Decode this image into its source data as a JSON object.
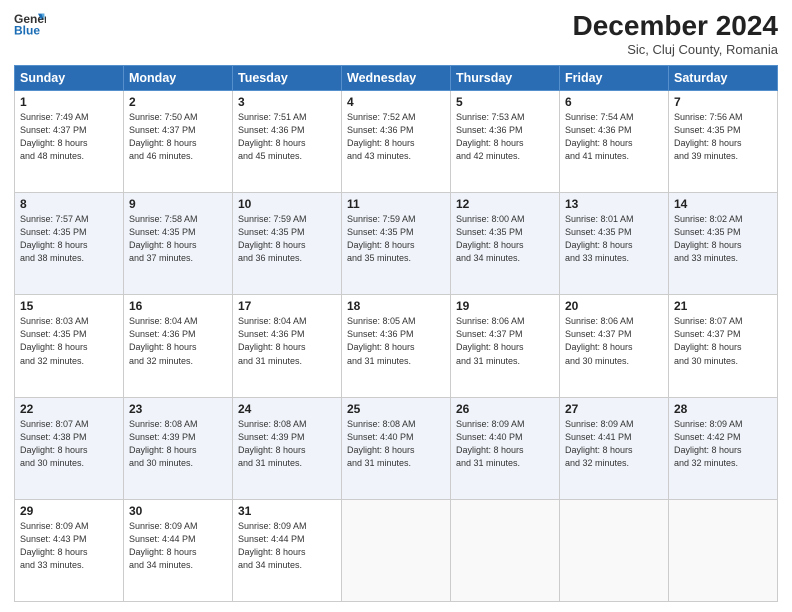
{
  "header": {
    "logo_line1": "General",
    "logo_line2": "Blue",
    "month": "December 2024",
    "location": "Sic, Cluj County, Romania"
  },
  "weekdays": [
    "Sunday",
    "Monday",
    "Tuesday",
    "Wednesday",
    "Thursday",
    "Friday",
    "Saturday"
  ],
  "weeks": [
    [
      {
        "day": "1",
        "info": "Sunrise: 7:49 AM\nSunset: 4:37 PM\nDaylight: 8 hours\nand 48 minutes."
      },
      {
        "day": "2",
        "info": "Sunrise: 7:50 AM\nSunset: 4:37 PM\nDaylight: 8 hours\nand 46 minutes."
      },
      {
        "day": "3",
        "info": "Sunrise: 7:51 AM\nSunset: 4:36 PM\nDaylight: 8 hours\nand 45 minutes."
      },
      {
        "day": "4",
        "info": "Sunrise: 7:52 AM\nSunset: 4:36 PM\nDaylight: 8 hours\nand 43 minutes."
      },
      {
        "day": "5",
        "info": "Sunrise: 7:53 AM\nSunset: 4:36 PM\nDaylight: 8 hours\nand 42 minutes."
      },
      {
        "day": "6",
        "info": "Sunrise: 7:54 AM\nSunset: 4:36 PM\nDaylight: 8 hours\nand 41 minutes."
      },
      {
        "day": "7",
        "info": "Sunrise: 7:56 AM\nSunset: 4:35 PM\nDaylight: 8 hours\nand 39 minutes."
      }
    ],
    [
      {
        "day": "8",
        "info": "Sunrise: 7:57 AM\nSunset: 4:35 PM\nDaylight: 8 hours\nand 38 minutes."
      },
      {
        "day": "9",
        "info": "Sunrise: 7:58 AM\nSunset: 4:35 PM\nDaylight: 8 hours\nand 37 minutes."
      },
      {
        "day": "10",
        "info": "Sunrise: 7:59 AM\nSunset: 4:35 PM\nDaylight: 8 hours\nand 36 minutes."
      },
      {
        "day": "11",
        "info": "Sunrise: 7:59 AM\nSunset: 4:35 PM\nDaylight: 8 hours\nand 35 minutes."
      },
      {
        "day": "12",
        "info": "Sunrise: 8:00 AM\nSunset: 4:35 PM\nDaylight: 8 hours\nand 34 minutes."
      },
      {
        "day": "13",
        "info": "Sunrise: 8:01 AM\nSunset: 4:35 PM\nDaylight: 8 hours\nand 33 minutes."
      },
      {
        "day": "14",
        "info": "Sunrise: 8:02 AM\nSunset: 4:35 PM\nDaylight: 8 hours\nand 33 minutes."
      }
    ],
    [
      {
        "day": "15",
        "info": "Sunrise: 8:03 AM\nSunset: 4:35 PM\nDaylight: 8 hours\nand 32 minutes."
      },
      {
        "day": "16",
        "info": "Sunrise: 8:04 AM\nSunset: 4:36 PM\nDaylight: 8 hours\nand 32 minutes."
      },
      {
        "day": "17",
        "info": "Sunrise: 8:04 AM\nSunset: 4:36 PM\nDaylight: 8 hours\nand 31 minutes."
      },
      {
        "day": "18",
        "info": "Sunrise: 8:05 AM\nSunset: 4:36 PM\nDaylight: 8 hours\nand 31 minutes."
      },
      {
        "day": "19",
        "info": "Sunrise: 8:06 AM\nSunset: 4:37 PM\nDaylight: 8 hours\nand 31 minutes."
      },
      {
        "day": "20",
        "info": "Sunrise: 8:06 AM\nSunset: 4:37 PM\nDaylight: 8 hours\nand 30 minutes."
      },
      {
        "day": "21",
        "info": "Sunrise: 8:07 AM\nSunset: 4:37 PM\nDaylight: 8 hours\nand 30 minutes."
      }
    ],
    [
      {
        "day": "22",
        "info": "Sunrise: 8:07 AM\nSunset: 4:38 PM\nDaylight: 8 hours\nand 30 minutes."
      },
      {
        "day": "23",
        "info": "Sunrise: 8:08 AM\nSunset: 4:39 PM\nDaylight: 8 hours\nand 30 minutes."
      },
      {
        "day": "24",
        "info": "Sunrise: 8:08 AM\nSunset: 4:39 PM\nDaylight: 8 hours\nand 31 minutes."
      },
      {
        "day": "25",
        "info": "Sunrise: 8:08 AM\nSunset: 4:40 PM\nDaylight: 8 hours\nand 31 minutes."
      },
      {
        "day": "26",
        "info": "Sunrise: 8:09 AM\nSunset: 4:40 PM\nDaylight: 8 hours\nand 31 minutes."
      },
      {
        "day": "27",
        "info": "Sunrise: 8:09 AM\nSunset: 4:41 PM\nDaylight: 8 hours\nand 32 minutes."
      },
      {
        "day": "28",
        "info": "Sunrise: 8:09 AM\nSunset: 4:42 PM\nDaylight: 8 hours\nand 32 minutes."
      }
    ],
    [
      {
        "day": "29",
        "info": "Sunrise: 8:09 AM\nSunset: 4:43 PM\nDaylight: 8 hours\nand 33 minutes."
      },
      {
        "day": "30",
        "info": "Sunrise: 8:09 AM\nSunset: 4:44 PM\nDaylight: 8 hours\nand 34 minutes."
      },
      {
        "day": "31",
        "info": "Sunrise: 8:09 AM\nSunset: 4:44 PM\nDaylight: 8 hours\nand 34 minutes."
      },
      null,
      null,
      null,
      null
    ]
  ]
}
